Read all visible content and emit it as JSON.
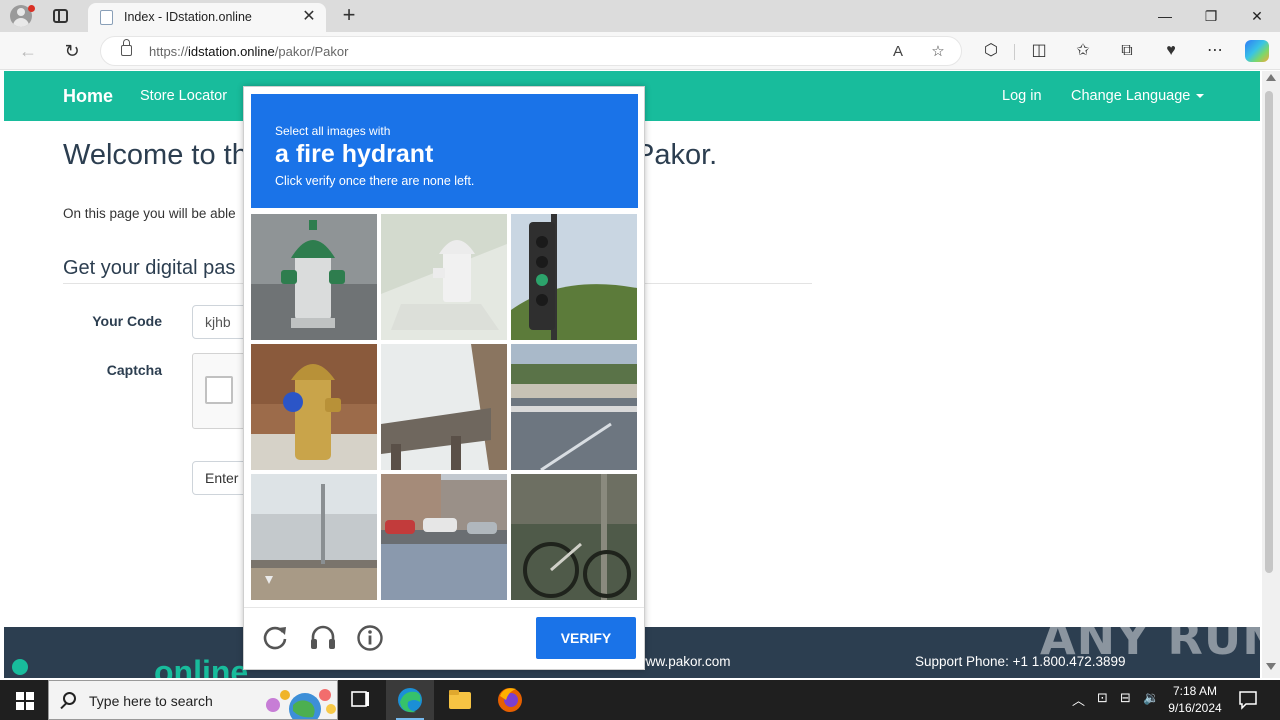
{
  "browser": {
    "tab_title": "Index - IDstation.online",
    "url_scheme": "https://",
    "url_host": "idstation.online",
    "url_path": "/pakor/Pakor"
  },
  "site": {
    "nav": {
      "brand": "Home",
      "store_locator": "Store Locator",
      "login": "Log in",
      "change_language": "Change Language"
    },
    "heading_start": "Welcome to th",
    "heading_end": "Pakor.",
    "intro": "On this page you will be able",
    "section_title": "Get your digital pas",
    "form": {
      "code_label": "Your Code",
      "code_value": "kjhb",
      "captcha_label": "Captcha",
      "enter_label": "Enter"
    },
    "footer": {
      "logo": "online",
      "website": "www.pakor.com",
      "phone": "Support Phone: +1 1.800.472.3899"
    }
  },
  "captcha": {
    "select_prompt": "Select all images with",
    "target": "a fire hydrant",
    "instruction": "Click verify once there are none left.",
    "verify_label": "VERIFY",
    "tiles": [
      {
        "subject": "fire-hydrant-green",
        "faded": false
      },
      {
        "subject": "fire-hydrant-faded",
        "faded": true
      },
      {
        "subject": "traffic-light",
        "faded": false
      },
      {
        "subject": "fire-hydrant-yellow",
        "faded": false
      },
      {
        "subject": "bridge-overpass",
        "faded": false
      },
      {
        "subject": "road-bridge",
        "faded": false
      },
      {
        "subject": "bridge-railing",
        "faded": false
      },
      {
        "subject": "street-cars",
        "faded": false
      },
      {
        "subject": "bicycle",
        "faded": false
      }
    ]
  },
  "watermark": "ANY RUN",
  "taskbar": {
    "search_placeholder": "Type here to search",
    "time": "7:18 AM",
    "date": "9/16/2024"
  },
  "colors": {
    "navbar": "#18bc9c",
    "footer": "#2c3e50",
    "captcha_blue": "#1a73e8"
  }
}
